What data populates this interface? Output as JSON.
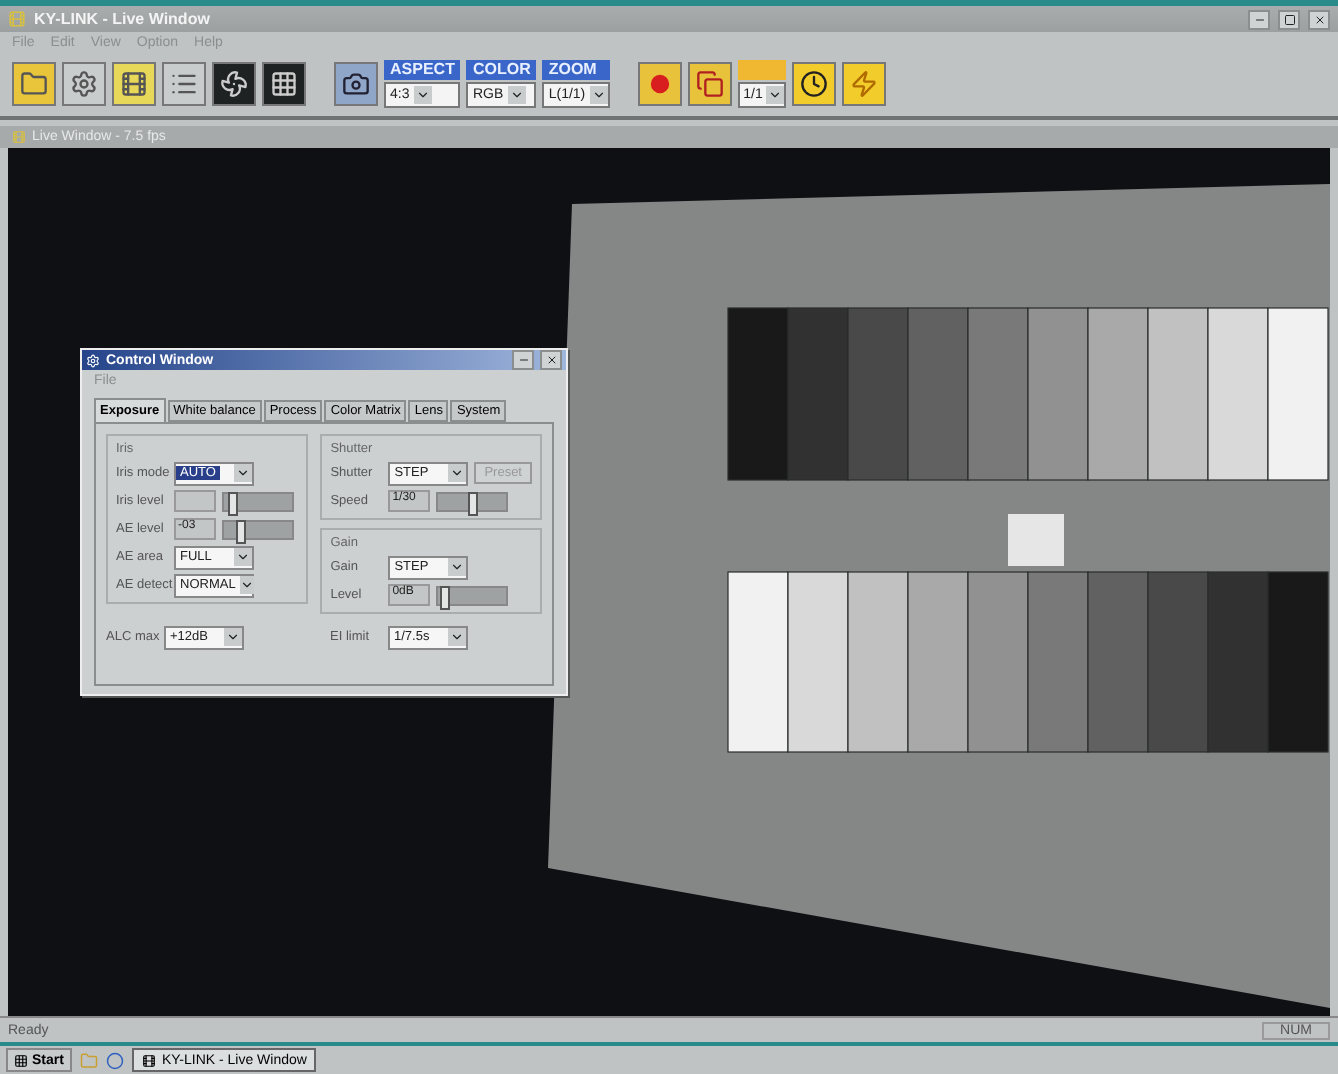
{
  "app": {
    "title": "KY-LINK - Live Window",
    "menu": [
      "File",
      "Edit",
      "View",
      "Option",
      "Help"
    ]
  },
  "toolbar": {
    "selects": [
      {
        "label": "ASPECT",
        "value": "4:3"
      },
      {
        "label": "COLOR",
        "value": "RGB"
      },
      {
        "label": "ZOOM",
        "value": "L(1/1)"
      }
    ],
    "ratio": {
      "value": "1/1"
    }
  },
  "live_window": {
    "title": "Live Window - 7.5 fps"
  },
  "control_window": {
    "title": "Control Window",
    "menu": [
      "File"
    ],
    "tabs": [
      {
        "label": "Exposure",
        "selected": true
      },
      {
        "label": "White balance",
        "selected": false
      },
      {
        "label": "Process",
        "selected": false
      },
      {
        "label": "Color Matrix",
        "selected": false
      },
      {
        "label": "Lens",
        "selected": false
      },
      {
        "label": "System",
        "selected": false
      }
    ],
    "groups": [
      {
        "title": "Iris",
        "rows": [
          {
            "kind": "select",
            "label": "Iris mode",
            "value": "AUTO",
            "focused": true
          },
          {
            "kind": "slider",
            "label": "Iris level",
            "disabled": true,
            "level": 0.05
          },
          {
            "kind": "slider",
            "label": "AE level",
            "value": "-03",
            "disabled": true,
            "level": 0.2
          },
          {
            "kind": "select",
            "label": "AE area",
            "value": "FULL",
            "focused": false
          },
          {
            "kind": "select",
            "label": "AE detect",
            "value": "NORMAL",
            "focused": false
          }
        ]
      },
      {
        "title": "Shutter",
        "rows": [
          {
            "kind": "select",
            "label": "Shutter",
            "value": "STEP",
            "focused": false,
            "button": {
              "label": "Preset",
              "disabled": true
            }
          },
          {
            "kind": "slider",
            "label": "Speed",
            "value": "1/30",
            "disabled": true,
            "level": 0.5
          }
        ]
      },
      {
        "title": "Gain",
        "rows": [
          {
            "kind": "select",
            "label": "Gain",
            "value": "STEP",
            "focused": false
          },
          {
            "kind": "slider",
            "label": "Level",
            "value": "0dB",
            "disabled": true,
            "level": 0.03
          }
        ]
      }
    ],
    "bottom": [
      {
        "label": "ALC max",
        "value": "+12dB"
      },
      {
        "label": "EI limit",
        "value": "1/7.5s"
      }
    ]
  },
  "status_bar": {
    "text": "Ready",
    "indicator": "NUM"
  },
  "taskbar": {
    "start": "Start",
    "tasks": [
      {
        "label": "KY-LINK - Live Window",
        "selected": true
      }
    ]
  }
}
